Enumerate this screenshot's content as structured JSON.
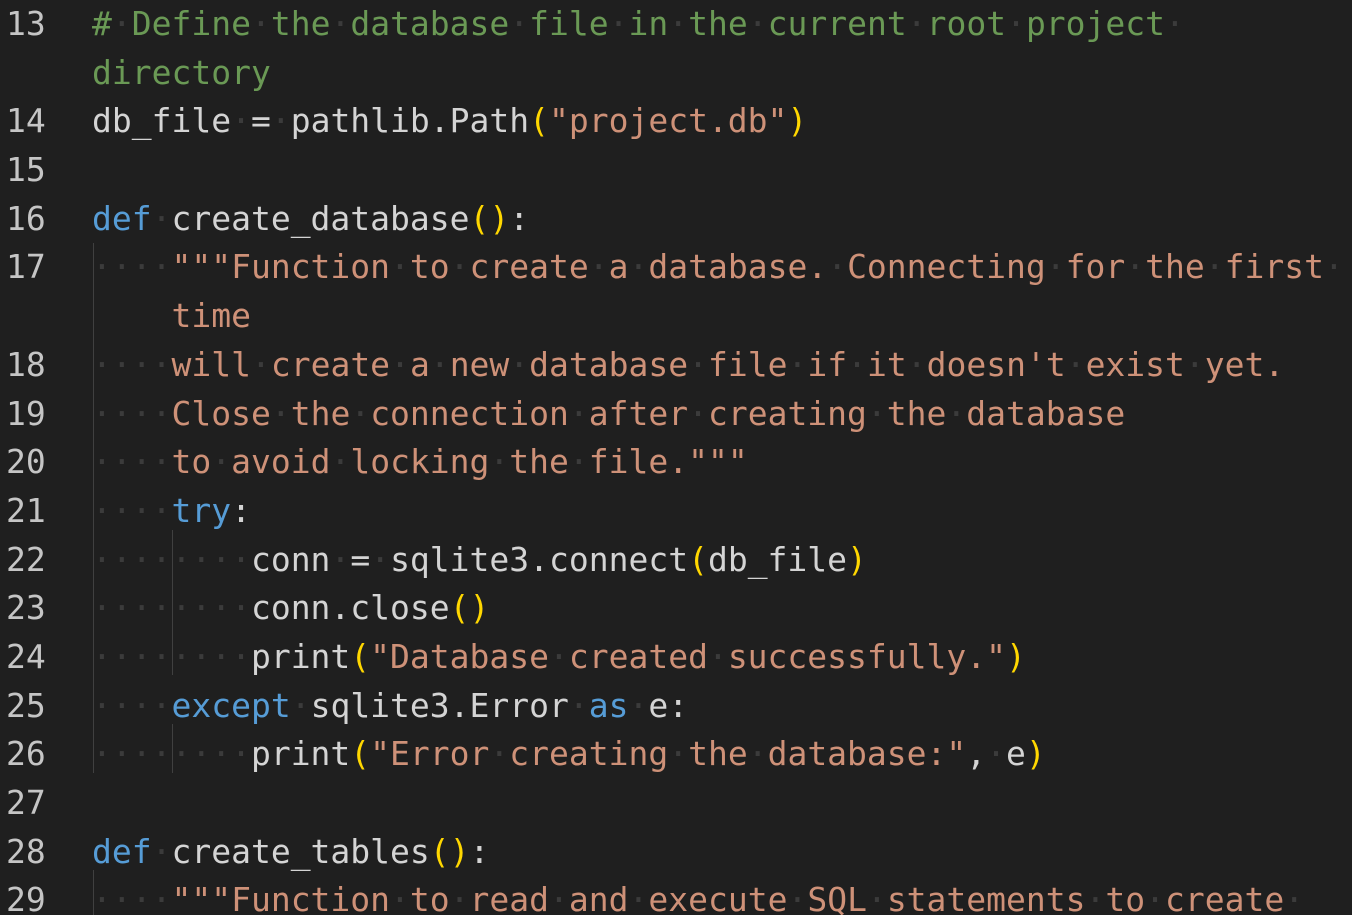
{
  "editor": {
    "lines": [
      {
        "number": "13",
        "segments": [
          {
            "t": "#",
            "c": "cm"
          },
          {
            "t": "·",
            "c": "ws"
          },
          {
            "t": "Define",
            "c": "cm"
          },
          {
            "t": "·",
            "c": "ws"
          },
          {
            "t": "the",
            "c": "cm"
          },
          {
            "t": "·",
            "c": "ws"
          },
          {
            "t": "database",
            "c": "cm"
          },
          {
            "t": "·",
            "c": "ws"
          },
          {
            "t": "file",
            "c": "cm"
          },
          {
            "t": "·",
            "c": "ws"
          },
          {
            "t": "in",
            "c": "cm"
          },
          {
            "t": "·",
            "c": "ws"
          },
          {
            "t": "the",
            "c": "cm"
          },
          {
            "t": "·",
            "c": "ws"
          },
          {
            "t": "current",
            "c": "cm"
          },
          {
            "t": "·",
            "c": "ws"
          },
          {
            "t": "root",
            "c": "cm"
          },
          {
            "t": "·",
            "c": "ws"
          },
          {
            "t": "project",
            "c": "cm"
          },
          {
            "t": "·",
            "c": "ws"
          }
        ]
      },
      {
        "number": "",
        "segments": [
          {
            "t": "directory",
            "c": "cm"
          }
        ]
      },
      {
        "number": "14",
        "segments": [
          {
            "t": "db_file",
            "c": ""
          },
          {
            "t": "·",
            "c": "ws"
          },
          {
            "t": "=",
            "c": ""
          },
          {
            "t": "·",
            "c": "ws"
          },
          {
            "t": "pathlib.Path",
            "c": ""
          },
          {
            "t": "(",
            "c": "pn"
          },
          {
            "t": "\"project.db\"",
            "c": "str"
          },
          {
            "t": ")",
            "c": "pn"
          }
        ]
      },
      {
        "number": "15",
        "segments": []
      },
      {
        "number": "16",
        "segments": [
          {
            "t": "def",
            "c": "kw"
          },
          {
            "t": "·",
            "c": "ws"
          },
          {
            "t": "create_database",
            "c": ""
          },
          {
            "t": "()",
            "c": "pn"
          },
          {
            "t": ":",
            "c": ""
          }
        ]
      },
      {
        "number": "17",
        "segments": [
          {
            "t": "····",
            "c": "ws"
          },
          {
            "t": "\"\"\"Function",
            "c": "str"
          },
          {
            "t": "·",
            "c": "ws"
          },
          {
            "t": "to",
            "c": "str"
          },
          {
            "t": "·",
            "c": "ws"
          },
          {
            "t": "create",
            "c": "str"
          },
          {
            "t": "·",
            "c": "ws"
          },
          {
            "t": "a",
            "c": "str"
          },
          {
            "t": "·",
            "c": "ws"
          },
          {
            "t": "database.",
            "c": "str"
          },
          {
            "t": "·",
            "c": "ws"
          },
          {
            "t": "Connecting",
            "c": "str"
          },
          {
            "t": "·",
            "c": "ws"
          },
          {
            "t": "for",
            "c": "str"
          },
          {
            "t": "·",
            "c": "ws"
          },
          {
            "t": "the",
            "c": "str"
          },
          {
            "t": "·",
            "c": "ws"
          },
          {
            "t": "first",
            "c": "str"
          },
          {
            "t": "·",
            "c": "ws"
          }
        ]
      },
      {
        "number": "",
        "segments": [
          {
            "t": "    ",
            "c": ""
          },
          {
            "t": "time",
            "c": "str"
          }
        ]
      },
      {
        "number": "18",
        "segments": [
          {
            "t": "····",
            "c": "ws"
          },
          {
            "t": "will",
            "c": "str"
          },
          {
            "t": "·",
            "c": "ws"
          },
          {
            "t": "create",
            "c": "str"
          },
          {
            "t": "·",
            "c": "ws"
          },
          {
            "t": "a",
            "c": "str"
          },
          {
            "t": "·",
            "c": "ws"
          },
          {
            "t": "new",
            "c": "str"
          },
          {
            "t": "·",
            "c": "ws"
          },
          {
            "t": "database",
            "c": "str"
          },
          {
            "t": "·",
            "c": "ws"
          },
          {
            "t": "file",
            "c": "str"
          },
          {
            "t": "·",
            "c": "ws"
          },
          {
            "t": "if",
            "c": "str"
          },
          {
            "t": "·",
            "c": "ws"
          },
          {
            "t": "it",
            "c": "str"
          },
          {
            "t": "·",
            "c": "ws"
          },
          {
            "t": "doesn't",
            "c": "str"
          },
          {
            "t": "·",
            "c": "ws"
          },
          {
            "t": "exist",
            "c": "str"
          },
          {
            "t": "·",
            "c": "ws"
          },
          {
            "t": "yet.",
            "c": "str"
          }
        ]
      },
      {
        "number": "19",
        "segments": [
          {
            "t": "····",
            "c": "ws"
          },
          {
            "t": "Close",
            "c": "str"
          },
          {
            "t": "·",
            "c": "ws"
          },
          {
            "t": "the",
            "c": "str"
          },
          {
            "t": "·",
            "c": "ws"
          },
          {
            "t": "connection",
            "c": "str"
          },
          {
            "t": "·",
            "c": "ws"
          },
          {
            "t": "after",
            "c": "str"
          },
          {
            "t": "·",
            "c": "ws"
          },
          {
            "t": "creating",
            "c": "str"
          },
          {
            "t": "·",
            "c": "ws"
          },
          {
            "t": "the",
            "c": "str"
          },
          {
            "t": "·",
            "c": "ws"
          },
          {
            "t": "database",
            "c": "str"
          }
        ]
      },
      {
        "number": "20",
        "segments": [
          {
            "t": "····",
            "c": "ws"
          },
          {
            "t": "to",
            "c": "str"
          },
          {
            "t": "·",
            "c": "ws"
          },
          {
            "t": "avoid",
            "c": "str"
          },
          {
            "t": "·",
            "c": "ws"
          },
          {
            "t": "locking",
            "c": "str"
          },
          {
            "t": "·",
            "c": "ws"
          },
          {
            "t": "the",
            "c": "str"
          },
          {
            "t": "·",
            "c": "ws"
          },
          {
            "t": "file.\"\"\"",
            "c": "str"
          }
        ]
      },
      {
        "number": "21",
        "segments": [
          {
            "t": "····",
            "c": "ws"
          },
          {
            "t": "try",
            "c": "kw"
          },
          {
            "t": ":",
            "c": ""
          }
        ]
      },
      {
        "number": "22",
        "segments": [
          {
            "t": "········",
            "c": "ws"
          },
          {
            "t": "conn",
            "c": ""
          },
          {
            "t": "·",
            "c": "ws"
          },
          {
            "t": "=",
            "c": ""
          },
          {
            "t": "·",
            "c": "ws"
          },
          {
            "t": "sqlite3.connect",
            "c": ""
          },
          {
            "t": "(",
            "c": "pn"
          },
          {
            "t": "db_file",
            "c": ""
          },
          {
            "t": ")",
            "c": "pn"
          }
        ]
      },
      {
        "number": "23",
        "segments": [
          {
            "t": "········",
            "c": "ws"
          },
          {
            "t": "conn.close",
            "c": ""
          },
          {
            "t": "()",
            "c": "pn"
          }
        ]
      },
      {
        "number": "24",
        "segments": [
          {
            "t": "········",
            "c": "ws"
          },
          {
            "t": "print",
            "c": ""
          },
          {
            "t": "(",
            "c": "pn"
          },
          {
            "t": "\"Database",
            "c": "str"
          },
          {
            "t": "·",
            "c": "ws"
          },
          {
            "t": "created",
            "c": "str"
          },
          {
            "t": "·",
            "c": "ws"
          },
          {
            "t": "successfully.\"",
            "c": "str"
          },
          {
            "t": ")",
            "c": "pn"
          }
        ]
      },
      {
        "number": "25",
        "segments": [
          {
            "t": "····",
            "c": "ws"
          },
          {
            "t": "except",
            "c": "kw"
          },
          {
            "t": "·",
            "c": "ws"
          },
          {
            "t": "sqlite3.Error",
            "c": ""
          },
          {
            "t": "·",
            "c": "ws"
          },
          {
            "t": "as",
            "c": "kw"
          },
          {
            "t": "·",
            "c": "ws"
          },
          {
            "t": "e:",
            "c": ""
          }
        ]
      },
      {
        "number": "26",
        "segments": [
          {
            "t": "········",
            "c": "ws"
          },
          {
            "t": "print",
            "c": ""
          },
          {
            "t": "(",
            "c": "pn"
          },
          {
            "t": "\"Error",
            "c": "str"
          },
          {
            "t": "·",
            "c": "ws"
          },
          {
            "t": "creating",
            "c": "str"
          },
          {
            "t": "·",
            "c": "ws"
          },
          {
            "t": "the",
            "c": "str"
          },
          {
            "t": "·",
            "c": "ws"
          },
          {
            "t": "database:\"",
            "c": "str"
          },
          {
            "t": ",",
            "c": ""
          },
          {
            "t": "·",
            "c": "ws"
          },
          {
            "t": "e",
            "c": ""
          },
          {
            "t": ")",
            "c": "pn"
          }
        ]
      },
      {
        "number": "27",
        "segments": []
      },
      {
        "number": "28",
        "segments": [
          {
            "t": "def",
            "c": "kw"
          },
          {
            "t": "·",
            "c": "ws"
          },
          {
            "t": "create_tables",
            "c": ""
          },
          {
            "t": "()",
            "c": "pn"
          },
          {
            "t": ":",
            "c": ""
          }
        ]
      },
      {
        "number": "29",
        "segments": [
          {
            "t": "····",
            "c": "ws"
          },
          {
            "t": "\"\"\"Function",
            "c": "str"
          },
          {
            "t": "·",
            "c": "ws"
          },
          {
            "t": "to",
            "c": "str"
          },
          {
            "t": "·",
            "c": "ws"
          },
          {
            "t": "read",
            "c": "str"
          },
          {
            "t": "·",
            "c": "ws"
          },
          {
            "t": "and",
            "c": "str"
          },
          {
            "t": "·",
            "c": "ws"
          },
          {
            "t": "execute",
            "c": "str"
          },
          {
            "t": "·",
            "c": "ws"
          },
          {
            "t": "SQL",
            "c": "str"
          },
          {
            "t": "·",
            "c": "ws"
          },
          {
            "t": "statements",
            "c": "str"
          },
          {
            "t": "·",
            "c": "ws"
          },
          {
            "t": "to",
            "c": "str"
          },
          {
            "t": "·",
            "c": "ws"
          },
          {
            "t": "create",
            "c": "str"
          },
          {
            "t": "·",
            "c": "ws"
          }
        ]
      }
    ]
  },
  "colors": {
    "background": "#1f1f1f",
    "keyword": "#569cd6",
    "string": "#ce9178",
    "comment": "#6a9955",
    "bracket": "#ffd700",
    "default": "#d4d4d4",
    "line_number": "#c5c5c5",
    "whitespace_marker": "#3b3b3b"
  }
}
